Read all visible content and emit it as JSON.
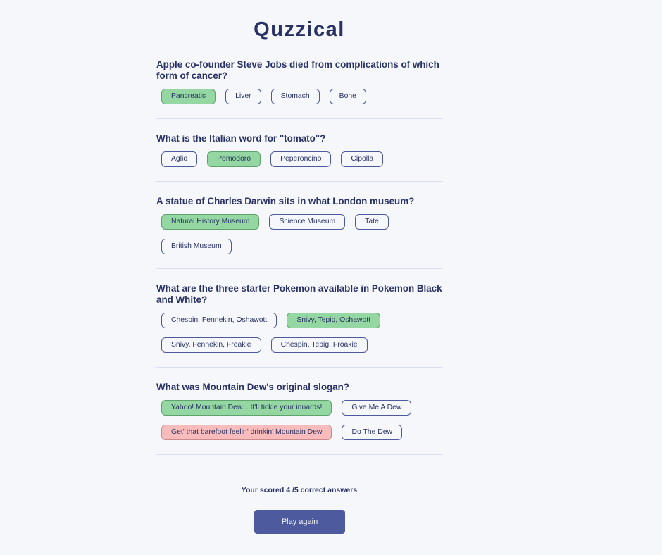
{
  "app": {
    "title": "Quzzical"
  },
  "questions": [
    {
      "text": "Apple co-founder Steve Jobs died from complications of which form of cancer?",
      "answers": [
        {
          "label": "Pancreatic",
          "state": "correct"
        },
        {
          "label": "Liver",
          "state": "neutral"
        },
        {
          "label": "Stomach",
          "state": "neutral"
        },
        {
          "label": "Bone",
          "state": "neutral"
        }
      ]
    },
    {
      "text": "What is the Italian word for \"tomato\"?",
      "answers": [
        {
          "label": "Aglio",
          "state": "neutral"
        },
        {
          "label": "Pomodoro",
          "state": "correct"
        },
        {
          "label": "Peperoncino",
          "state": "neutral"
        },
        {
          "label": "Cipolla",
          "state": "neutral"
        }
      ]
    },
    {
      "text": "A statue of Charles Darwin sits in what London museum?",
      "answers": [
        {
          "label": "Natural History Museum",
          "state": "correct"
        },
        {
          "label": "Science Museum",
          "state": "neutral"
        },
        {
          "label": "Tate",
          "state": "neutral"
        },
        {
          "label": "British Museum",
          "state": "neutral"
        }
      ]
    },
    {
      "text": "What are the three starter Pokemon available in Pokemon Black and White?",
      "answers": [
        {
          "label": "Chespin, Fennekin, Oshawott",
          "state": "neutral"
        },
        {
          "label": "Snivy, Tepig, Oshawott",
          "state": "correct"
        },
        {
          "label": "Snivy, Fennekin, Froakie",
          "state": "neutral"
        },
        {
          "label": "Chespin, Tepig, Froakie",
          "state": "neutral"
        }
      ]
    },
    {
      "text": "What was Mountain Dew's original slogan?",
      "answers": [
        {
          "label": "Yahoo! Mountain Dew... It'll tickle your innards!",
          "state": "correct"
        },
        {
          "label": "Give Me A Dew",
          "state": "neutral"
        },
        {
          "label": "Get' that barefoot feelin' drinkin' Mountain Dew",
          "state": "wrong"
        },
        {
          "label": "Do The Dew",
          "state": "neutral"
        }
      ]
    }
  ],
  "result": {
    "score_text": "Your scored 4 /5 correct answers",
    "score": 4,
    "total": 5
  },
  "actions": {
    "play_again_label": "Play again"
  },
  "colors": {
    "background": "#f5f7fb",
    "text": "#293264",
    "accent": "#4d5b9e",
    "correct": "#94d7a2",
    "wrong": "#f8bcbc"
  }
}
